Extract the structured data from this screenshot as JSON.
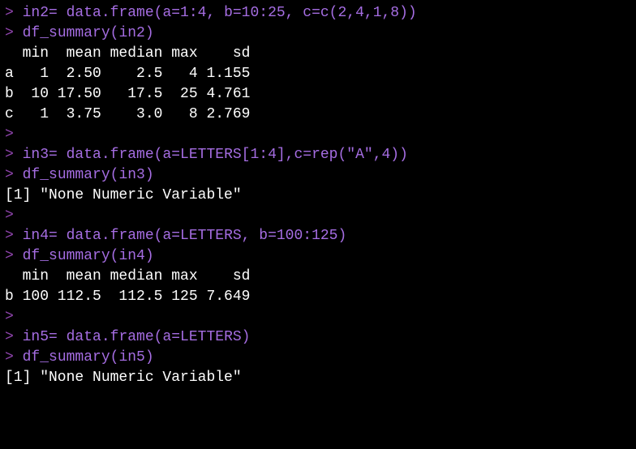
{
  "lines": [
    {
      "type": "input",
      "text": "in2= data.frame(a=1:4, b=10:25, c=c(2,4,1,8))"
    },
    {
      "type": "input",
      "text": "df_summary(in2)"
    },
    {
      "type": "output",
      "text": "  min  mean median max    sd"
    },
    {
      "type": "output",
      "text": "a   1  2.50    2.5   4 1.155"
    },
    {
      "type": "output",
      "text": "b  10 17.50   17.5  25 4.761"
    },
    {
      "type": "output",
      "text": "c   1  3.75    3.0   8 2.769"
    },
    {
      "type": "prompt_only",
      "text": ""
    },
    {
      "type": "input",
      "text": "in3= data.frame(a=LETTERS[1:4],c=rep(\"A\",4))"
    },
    {
      "type": "input",
      "text": "df_summary(in3)"
    },
    {
      "type": "output",
      "text": "[1] \"None Numeric Variable\""
    },
    {
      "type": "prompt_only",
      "text": ""
    },
    {
      "type": "input",
      "text": "in4= data.frame(a=LETTERS, b=100:125)"
    },
    {
      "type": "input",
      "text": "df_summary(in4)"
    },
    {
      "type": "output",
      "text": "  min  mean median max    sd"
    },
    {
      "type": "output",
      "text": "b 100 112.5  112.5 125 7.649"
    },
    {
      "type": "prompt_only",
      "text": ""
    },
    {
      "type": "input",
      "text": "in5= data.frame(a=LETTERS)"
    },
    {
      "type": "input",
      "text": "df_summary(in5)"
    },
    {
      "type": "output",
      "text": "[1] \"None Numeric Variable\""
    }
  ],
  "prompt_char": "> "
}
